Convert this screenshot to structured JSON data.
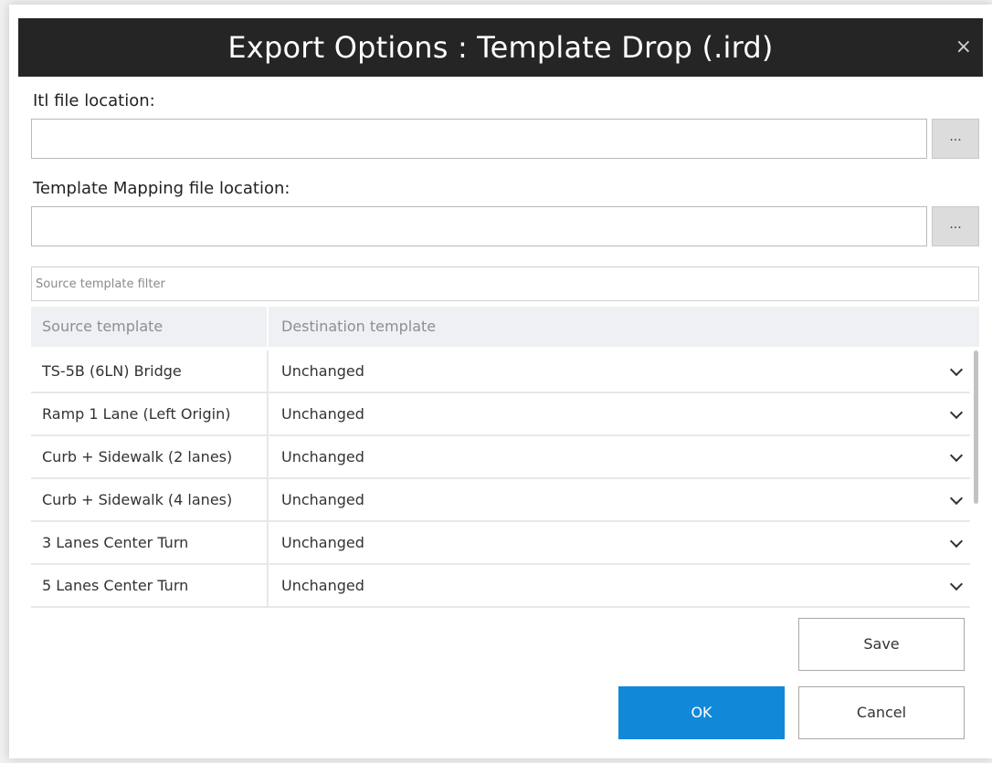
{
  "dialog": {
    "title": "Export Options : Template Drop (.ird)",
    "close_glyph": "×"
  },
  "itl": {
    "label": "Itl file location:",
    "value": "",
    "browse_label": "..."
  },
  "mapping": {
    "label": "Template Mapping file location:",
    "value": "",
    "browse_label": "..."
  },
  "filter": {
    "placeholder": "Source template filter",
    "value": ""
  },
  "grid": {
    "columns": [
      "Source template",
      "Destination template"
    ],
    "rows": [
      {
        "source": "TS-5B (6LN) Bridge",
        "destination": "Unchanged"
      },
      {
        "source": "Ramp 1 Lane (Left Origin)",
        "destination": "Unchanged"
      },
      {
        "source": "Curb + Sidewalk (2 lanes)",
        "destination": "Unchanged"
      },
      {
        "source": "Curb + Sidewalk (4 lanes)",
        "destination": "Unchanged"
      },
      {
        "source": "3 Lanes Center Turn",
        "destination": "Unchanged"
      },
      {
        "source": "5 Lanes Center Turn",
        "destination": "Unchanged"
      }
    ]
  },
  "buttons": {
    "save": "Save",
    "ok": "OK",
    "cancel": "Cancel"
  },
  "colors": {
    "title_bar": "#252525",
    "primary": "#1289d8"
  }
}
